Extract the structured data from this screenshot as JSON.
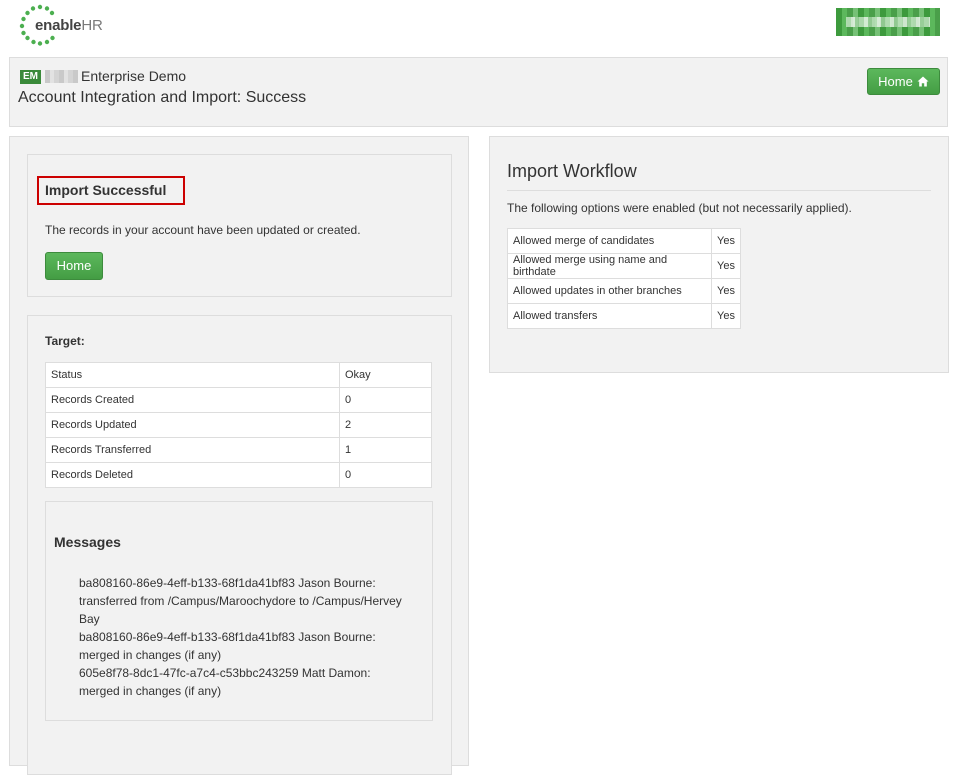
{
  "brand": {
    "logo_text_bold": "enable",
    "logo_text_rest": "HR"
  },
  "header": {
    "badge": "EM",
    "org_name": "Enterprise Demo",
    "title": "Account Integration and Import: Success",
    "home_label": "Home"
  },
  "success": {
    "title": "Import Successful",
    "text": "The records in your account have been updated or created.",
    "home_label": "Home"
  },
  "target": {
    "title": "Target:",
    "rows": [
      {
        "label": "Status",
        "value": "Okay"
      },
      {
        "label": "Records Created",
        "value": "0"
      },
      {
        "label": "Records Updated",
        "value": "2"
      },
      {
        "label": "Records Transferred",
        "value": "1"
      },
      {
        "label": "Records Deleted",
        "value": "0"
      }
    ]
  },
  "messages": {
    "title": "Messages",
    "items": [
      "ba808160-86e9-4eff-b133-68f1da41bf83 Jason Bourne: transferred from /Campus/Maroochydore to /Campus/Hervey Bay",
      "ba808160-86e9-4eff-b133-68f1da41bf83 Jason Bourne: merged in changes (if any)",
      "605e8f78-8dc1-47fc-a7c4-c53bbc243259 Matt Damon: merged in changes (if any)"
    ]
  },
  "workflow": {
    "title": "Import Workflow",
    "text": "The following options were enabled (but not necessarily applied).",
    "rows": [
      {
        "label": "Allowed merge of candidates",
        "value": "Yes"
      },
      {
        "label": "Allowed merge using name and birthdate",
        "value": "Yes"
      },
      {
        "label": "Allowed updates in other branches",
        "value": "Yes"
      },
      {
        "label": "Allowed transfers",
        "value": "Yes"
      }
    ]
  },
  "icons": {
    "home": "house-icon",
    "logo": "dotted-circle-logo"
  },
  "colors": {
    "accent_green": "#5cb85c",
    "highlight_red": "#cc0000",
    "panel_bg": "#f2f2f2"
  }
}
